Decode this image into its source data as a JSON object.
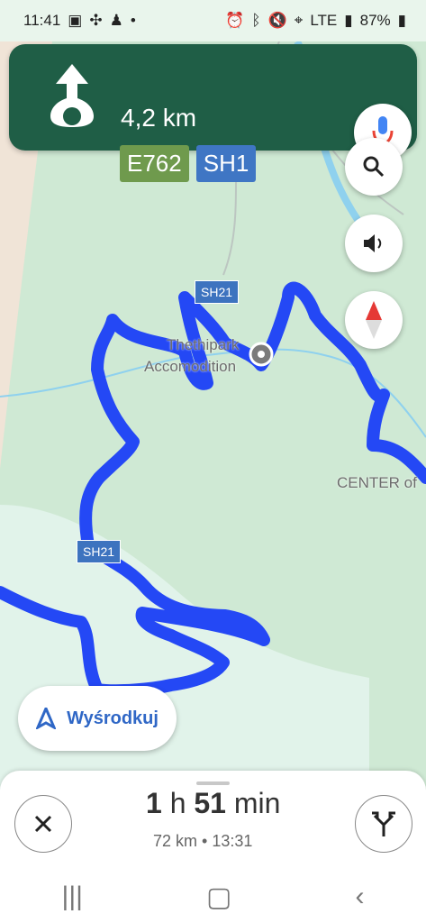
{
  "status": {
    "time": "11:41",
    "left_icons": [
      "notification-icon",
      "cast-icon",
      "activity-icon",
      "dot-icon"
    ],
    "battery_text": "87%",
    "network_text": "LTE"
  },
  "navigation": {
    "distance": "4,2 km",
    "roads": [
      "E762",
      "SH1"
    ]
  },
  "map": {
    "place_label": "Thethipark",
    "place_label_2": "Accomodition",
    "center_label": "CENTER of",
    "road_shield_1": "SH21",
    "road_shield_2": "SH21"
  },
  "controls": {
    "recenter_label": "Wyśrodkuj"
  },
  "trip": {
    "eta_hours": "1",
    "eta_hours_unit": "h",
    "eta_minutes": "51",
    "eta_minutes_unit": "min",
    "distance": "72 km",
    "arrival": "13:31"
  },
  "colors": {
    "route": "#2448f5",
    "map_green": "#cfe9d4",
    "nav_green": "#1f5e46",
    "water": "#8fd1ee"
  }
}
